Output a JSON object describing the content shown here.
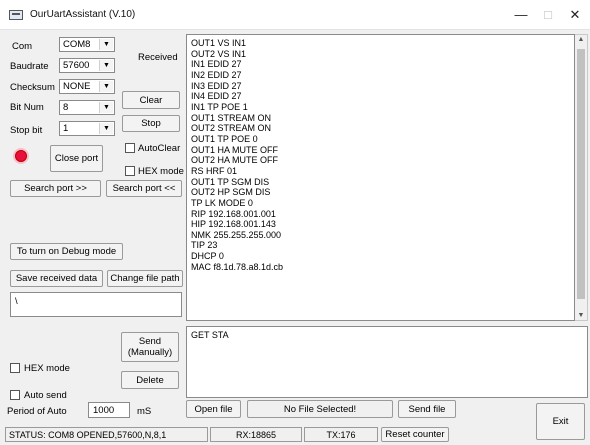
{
  "window": {
    "title": "OurUartAssistant (V.10)",
    "minimize": "—",
    "maximize": "□",
    "close": "✕"
  },
  "port": {
    "com_label": "Com",
    "com_value": "COM8",
    "baud_label": "Baudrate",
    "baud_value": "57600",
    "checksum_label": "Checksum",
    "checksum_value": "NONE",
    "bitnum_label": "Bit Num",
    "bitnum_value": "8",
    "stopbit_label": "Stop bit",
    "stopbit_value": "1",
    "close_port": "Close port",
    "search_port_next": "Search port >>",
    "search_port_prev": "Search port <<",
    "status_led_color": "#e8103a"
  },
  "receive": {
    "label": "Received",
    "clear": "Clear",
    "stop": "Stop",
    "auto_clear": "AutoClear",
    "hex_mode": "HEX mode",
    "lines": [
      "OUT1 VS IN1",
      "OUT2 VS IN1",
      "IN1 EDID 27",
      "IN2 EDID 27",
      "IN3 EDID 27",
      "IN4 EDID 27",
      "IN1 TP POE 1",
      "OUT1 STREAM ON",
      "OUT2 STREAM ON",
      "OUT1 TP POE 0",
      "OUT1 HA MUTE OFF",
      "OUT2 HA MUTE OFF",
      "RS HRF 01",
      "OUT1 TP SGM DIS",
      "OUT2 HP SGM DIS",
      "TP LK MODE 0",
      "RIP 192.168.001.001",
      "HIP 192.168.001.143",
      "NMK 255.255.255.000",
      "TIP 23",
      "DHCP 0",
      "MAC f8.1d.78.a8.1d.cb"
    ]
  },
  "debug": {
    "debug_button": "To turn on Debug mode",
    "save_received": "Save received data",
    "change_path": "Change file path",
    "path_value": "\\"
  },
  "send": {
    "text": "GET STA",
    "send_manually": "Send (Manually)",
    "hex_mode": "HEX mode",
    "delete": "Delete",
    "auto_send": "Auto send",
    "period_label": "Period of Auto",
    "period_value": "1000",
    "period_unit": "mS",
    "open_file": "Open file",
    "file_status": "No File Selected!",
    "send_file": "Send file",
    "exit": "Exit"
  },
  "statusbar": {
    "status": "STATUS: COM8 OPENED,57600,N,8,1",
    "rx": "RX:18865",
    "tx": "TX:176",
    "reset": "Reset counter"
  }
}
